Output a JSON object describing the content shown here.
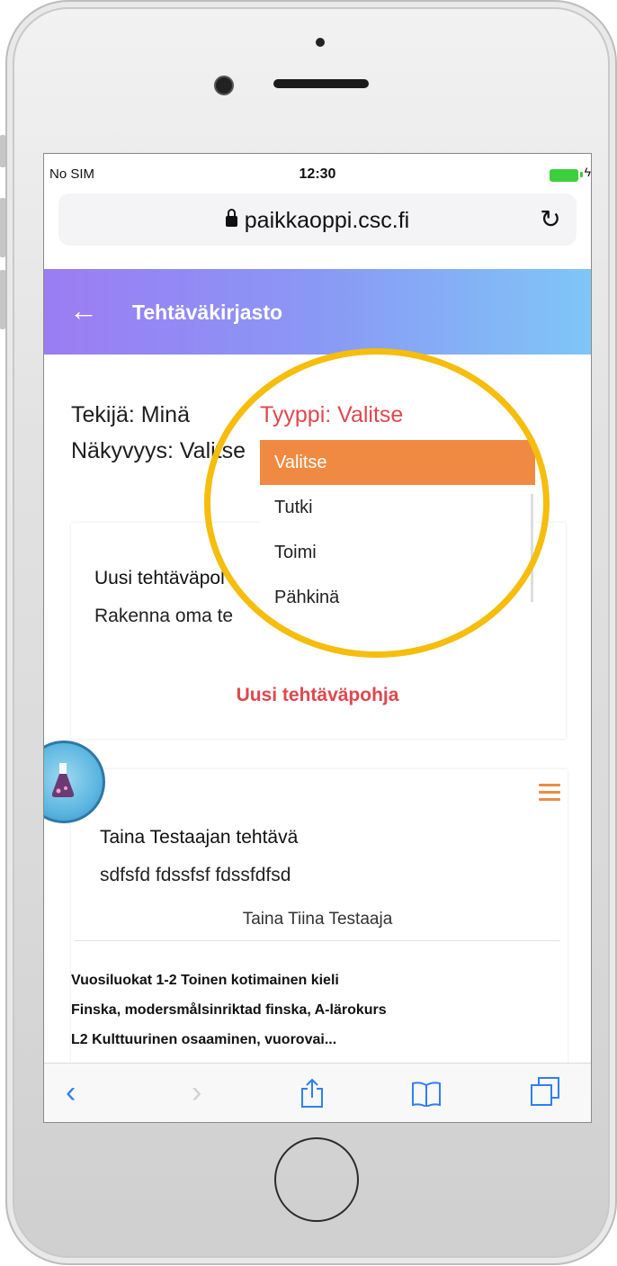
{
  "status_bar": {
    "carrier": "No SIM",
    "time": "12:30",
    "battery_color": "#3ccf3c"
  },
  "browser": {
    "url": "paikkaoppi.csc.fi",
    "lock_icon": "lock-icon",
    "reload_icon": "reload-icon"
  },
  "app_bar": {
    "title": "Tehtäväkirjasto",
    "back_icon": "arrow-left-icon",
    "gradient": [
      "#9b7cf3",
      "#7fc6f7"
    ]
  },
  "filters": {
    "author": "Tekijä: Minä",
    "type": "Tyyppi: Valitse",
    "visibility": "Näkyvyys: Valitse"
  },
  "dropdown": {
    "options": [
      "Valitse",
      "Tutki",
      "Toimi",
      "Pähkinä"
    ],
    "selected": "Valitse",
    "selected_color": "#f08a42"
  },
  "new_template_card": {
    "title": "Uusi tehtäväpol",
    "description": "Rakenna oma te",
    "action": "Uusi tehtäväpohja"
  },
  "task_card": {
    "title": "Taina Testaajan tehtävä",
    "description": "sdfsfd fdssfsf fdssfdfsd",
    "author": "Taina Tiina Testaaja",
    "meta_line1": "Vuosiluokat 1-2    Toinen kotimainen kieli",
    "meta_line2": "Finska, modersmålsinriktad finska, A-lärokurs",
    "meta_line3": "L2 Kulttuurinen osaaminen, vuorovai..."
  },
  "highlight_color": "#f6bd0c",
  "toolbar": {
    "back_icon": "chevron-left-icon",
    "forward_icon": "chevron-right-icon",
    "share_icon": "share-icon",
    "bookmarks_icon": "book-icon",
    "tabs_icon": "tabs-icon"
  }
}
